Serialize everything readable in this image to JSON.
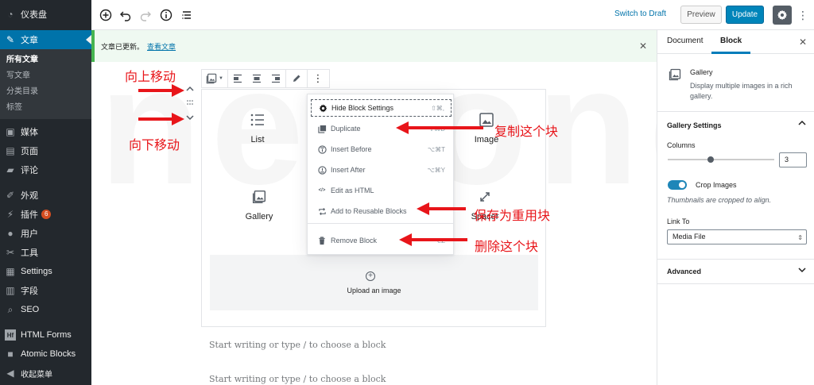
{
  "admin_menu": {
    "dashboard": "仪表盘",
    "posts": "文章",
    "posts_sub": [
      "所有文章",
      "写文章",
      "分类目录",
      "标签"
    ],
    "media": "媒体",
    "pages": "页面",
    "comments": "评论",
    "appearance": "外观",
    "plugins": "插件",
    "plugins_badge": "6",
    "users": "用户",
    "tools": "工具",
    "settings": "Settings",
    "fields": "字段",
    "seo": "SEO",
    "html_forms": "HTML Forms",
    "atomic_blocks": "Atomic Blocks",
    "collapse": "收起菜单"
  },
  "topbar": {
    "switch_to_draft": "Switch to Draft",
    "preview": "Preview",
    "update": "Update"
  },
  "notice": {
    "message": "文章已更新。",
    "link": "查看文章"
  },
  "panel": {
    "tabs": [
      "Document",
      "Block"
    ],
    "active_tab": "Block",
    "block_title": "Gallery",
    "block_description": "Display multiple images in a rich gallery.",
    "gallery_settings": "Gallery Settings",
    "columns_label": "Columns",
    "columns_value": "3",
    "crop_label": "Crop Images",
    "crop_enabled": true,
    "crop_help": "Thumbnails are cropped to align.",
    "link_to_label": "Link To",
    "link_to_value": "Media File",
    "advanced": "Advanced"
  },
  "editor": {
    "inserter_items": [
      "List",
      "Image",
      "Gallery",
      "Spacer"
    ],
    "upload_text": "Upload an image",
    "placeholder_1": "Start writing or type / to choose a block",
    "placeholder_2": "Start writing or type / to choose a block"
  },
  "block_menu": {
    "items": [
      {
        "label": "Hide Block Settings",
        "shortcut": "⇧⌘,",
        "icon": "gear-icon"
      },
      {
        "label": "Duplicate",
        "shortcut": "⇧⌘D",
        "icon": "duplicate-icon"
      },
      {
        "label": "Insert Before",
        "shortcut": "⌥⌘T",
        "icon": "insert-before-icon"
      },
      {
        "label": "Insert After",
        "shortcut": "⌥⌘Y",
        "icon": "insert-after-icon"
      },
      {
        "label": "Edit as HTML",
        "shortcut": "",
        "icon": "html-icon"
      },
      {
        "label": "Add to Reusable Blocks",
        "shortcut": "",
        "icon": "reusable-icon"
      },
      {
        "label": "Remove Block",
        "shortcut": "⌃⌥Z",
        "icon": "trash-icon"
      }
    ]
  },
  "annotations": {
    "move_up": "向上移动",
    "move_down": "向下移动",
    "duplicate": "复制这个块",
    "reusable": "保存为重用块",
    "remove": "删除这个块"
  },
  "colors": {
    "admin_bg": "#23282d",
    "accent": "#0073aa",
    "annotation": "#e8151a",
    "update_button": "#0085ba"
  }
}
